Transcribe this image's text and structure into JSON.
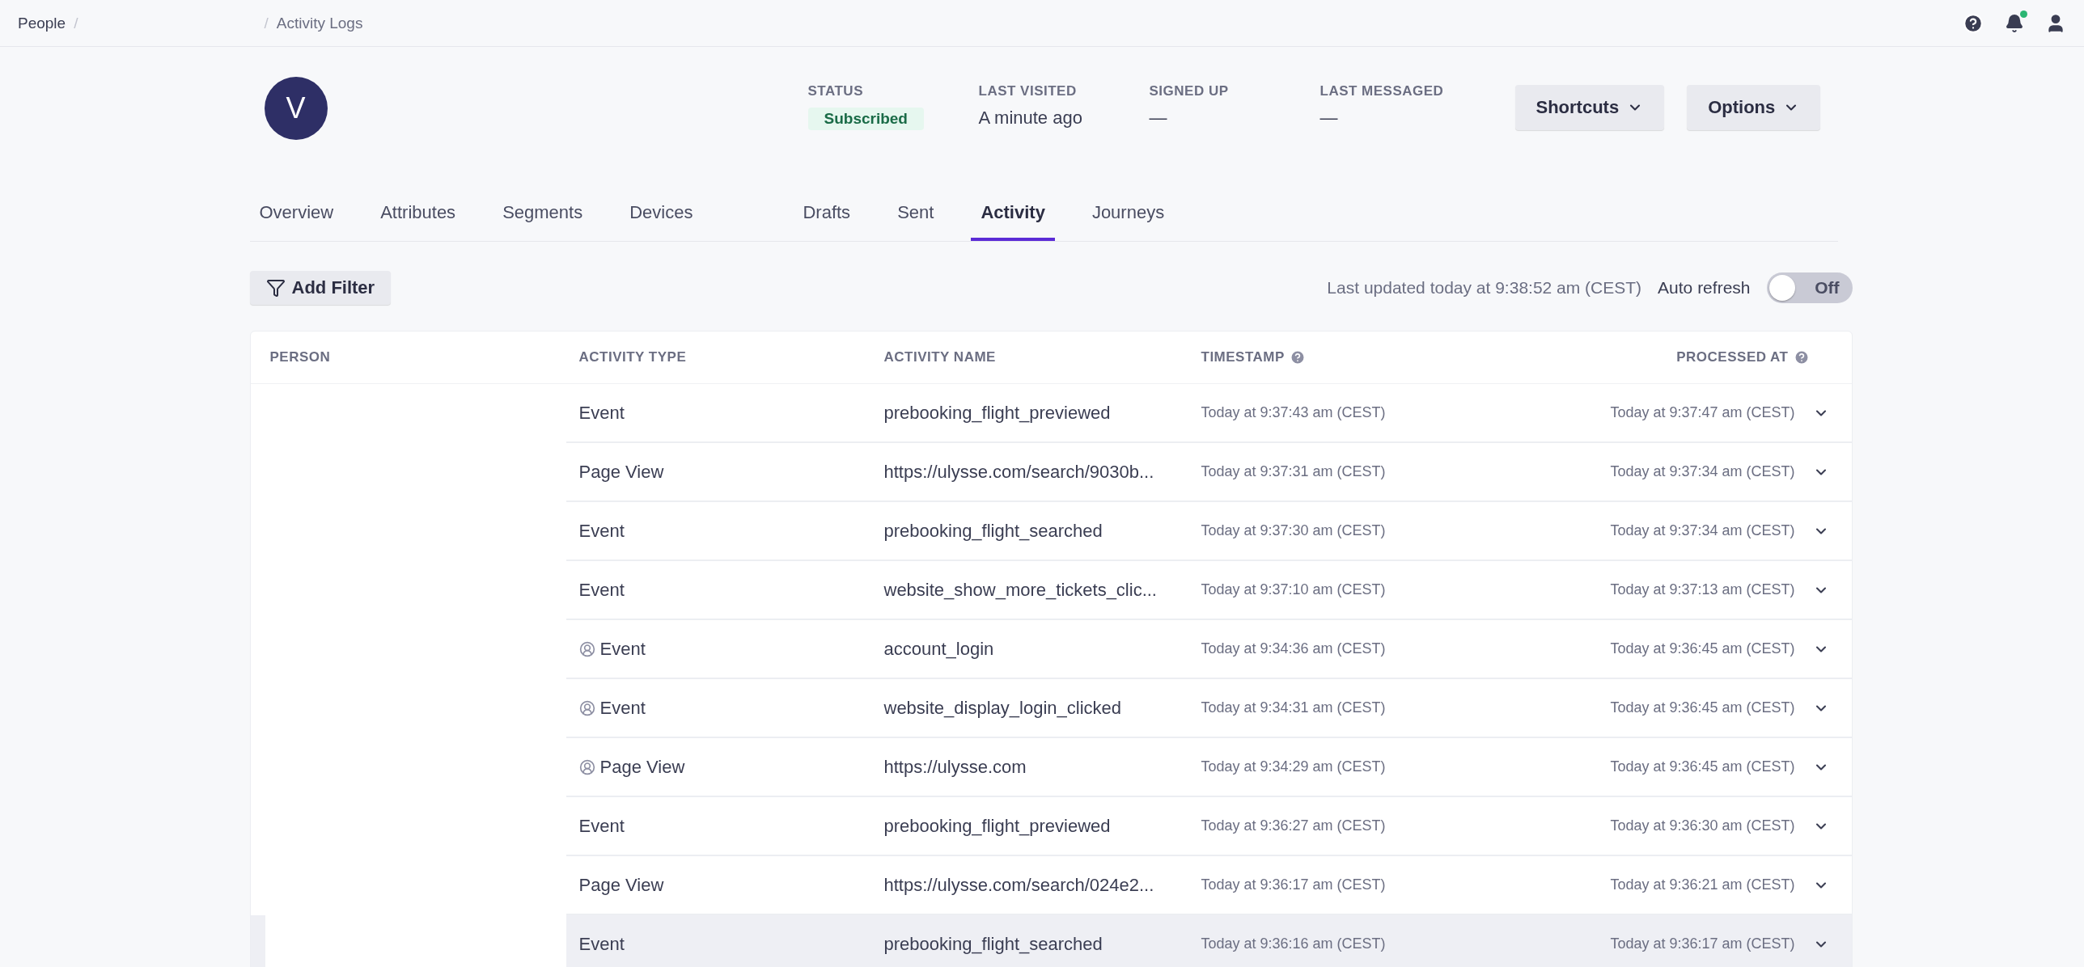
{
  "breadcrumb": [
    {
      "kind": "link",
      "text": "People"
    },
    {
      "kind": "separator",
      "text": "/"
    },
    {
      "kind": "separator",
      "text": "/"
    },
    {
      "kind": "current",
      "text": "Activity Logs"
    }
  ],
  "top_icons": {
    "notification_dot": true
  },
  "profile": {
    "avatar_initial": "V",
    "stats": [
      {
        "label": "STATUS",
        "value": "Subscribed",
        "kind": "badge"
      },
      {
        "label": "LAST VISITED",
        "value": "A minute ago",
        "kind": "text"
      },
      {
        "label": "SIGNED UP",
        "value": "—",
        "kind": "text"
      },
      {
        "label": "LAST MESSAGED",
        "value": "—",
        "kind": "text"
      }
    ],
    "buttons": [
      "Shortcuts",
      "Options"
    ]
  },
  "tabs": [
    [
      {
        "label": "Overview",
        "selected": false
      },
      {
        "label": "Attributes",
        "selected": false
      },
      {
        "label": "Segments",
        "selected": false
      },
      {
        "label": "Devices",
        "selected": false
      }
    ],
    [
      {
        "label": "Drafts",
        "selected": false
      },
      {
        "label": "Sent",
        "selected": false
      },
      {
        "label": "Activity",
        "selected": true
      },
      {
        "label": "Journeys",
        "selected": false
      }
    ]
  ],
  "toolbar": {
    "filter_button": "Add Filter",
    "last_updated": "Last updated today at 9:38:52 am (CEST)",
    "auto_refresh": {
      "label": "Auto refresh",
      "on": false,
      "state_text": "Off"
    }
  },
  "table": {
    "columns": [
      {
        "label": "PERSON"
      },
      {
        "label": "ACTIVITY TYPE"
      },
      {
        "label": "ACTIVITY NAME"
      },
      {
        "label": "TIMESTAMP",
        "help": true
      },
      {
        "label": "PROCESSED AT",
        "help": true
      }
    ],
    "rows": [
      {
        "type": "Event",
        "identified": false,
        "name": "prebooking_flight_previewed",
        "timestamp": "Today at 9:37:43 am (CEST)",
        "processed": "Today at 9:37:47 am (CEST)",
        "highlighted": false
      },
      {
        "type": "Page View",
        "identified": false,
        "name": "https://ulysse.com/search/9030b...",
        "timestamp": "Today at 9:37:31 am (CEST)",
        "processed": "Today at 9:37:34 am (CEST)",
        "highlighted": false
      },
      {
        "type": "Event",
        "identified": false,
        "name": "prebooking_flight_searched",
        "timestamp": "Today at 9:37:30 am (CEST)",
        "processed": "Today at 9:37:34 am (CEST)",
        "highlighted": false
      },
      {
        "type": "Event",
        "identified": false,
        "name": "website_show_more_tickets_clic...",
        "timestamp": "Today at 9:37:10 am (CEST)",
        "processed": "Today at 9:37:13 am (CEST)",
        "highlighted": false
      },
      {
        "type": "Event",
        "identified": true,
        "name": "account_login",
        "timestamp": "Today at 9:34:36 am (CEST)",
        "processed": "Today at 9:36:45 am (CEST)",
        "highlighted": false
      },
      {
        "type": "Event",
        "identified": true,
        "name": "website_display_login_clicked",
        "timestamp": "Today at 9:34:31 am (CEST)",
        "processed": "Today at 9:36:45 am (CEST)",
        "highlighted": false
      },
      {
        "type": "Page View",
        "identified": true,
        "name": "https://ulysse.com",
        "timestamp": "Today at 9:34:29 am (CEST)",
        "processed": "Today at 9:36:45 am (CEST)",
        "highlighted": false
      },
      {
        "type": "Event",
        "identified": false,
        "name": "prebooking_flight_previewed",
        "timestamp": "Today at 9:36:27 am (CEST)",
        "processed": "Today at 9:36:30 am (CEST)",
        "highlighted": false
      },
      {
        "type": "Page View",
        "identified": false,
        "name": "https://ulysse.com/search/024e2...",
        "timestamp": "Today at 9:36:17 am (CEST)",
        "processed": "Today at 9:36:21 am (CEST)",
        "highlighted": false
      },
      {
        "type": "Event",
        "identified": false,
        "name": "prebooking_flight_searched",
        "timestamp": "Today at 9:36:16 am (CEST)",
        "processed": "Today at 9:36:17 am (CEST)",
        "highlighted": true
      }
    ]
  }
}
